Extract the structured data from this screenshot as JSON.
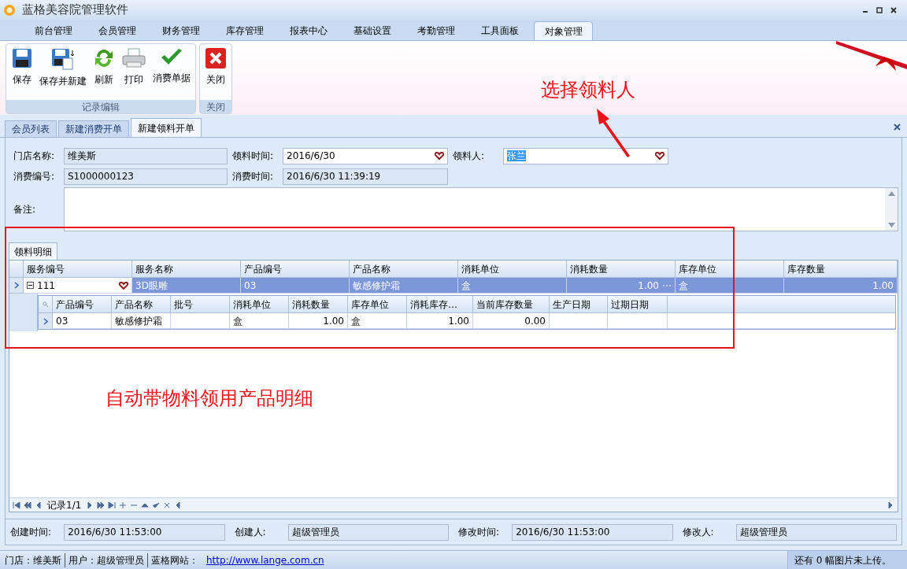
{
  "window": {
    "title": "蓝格美容院管理软件"
  },
  "menu_tabs": [
    {
      "label": "前台管理",
      "selected": false
    },
    {
      "label": "会员管理",
      "selected": false
    },
    {
      "label": "财务管理",
      "selected": false
    },
    {
      "label": "库存管理",
      "selected": false
    },
    {
      "label": "报表中心",
      "selected": false
    },
    {
      "label": "基础设置",
      "selected": false
    },
    {
      "label": "考勤管理",
      "selected": false
    },
    {
      "label": "工具面板",
      "selected": false
    },
    {
      "label": "对象管理",
      "selected": true
    }
  ],
  "ribbon": {
    "groups": [
      {
        "label": "记录编辑",
        "buttons": [
          {
            "label": "保存",
            "kind": "save"
          },
          {
            "label": "保存并新建",
            "kind": "save_new"
          },
          {
            "label": "刷新",
            "kind": "refresh"
          },
          {
            "label": "打印",
            "kind": "print"
          },
          {
            "label": "消费单据",
            "kind": "check"
          }
        ]
      },
      {
        "label": "关闭",
        "buttons": [
          {
            "label": "关闭",
            "kind": "close"
          }
        ]
      }
    ]
  },
  "doc_tabs": [
    {
      "label": "会员列表",
      "selected": false
    },
    {
      "label": "新建消费开单",
      "selected": false
    },
    {
      "label": "新建领料开单",
      "selected": true
    }
  ],
  "form": {
    "store": {
      "label": "门店名称:",
      "value": "维美斯"
    },
    "pick_time": {
      "label": "领料时间:",
      "value": "2016/6/30"
    },
    "picker": {
      "label": "领料人:",
      "value": "张兰",
      "selected": true
    },
    "consume_no": {
      "label": "消费编号:",
      "value": "S1000000123"
    },
    "consume_time": {
      "label": "消费时间:",
      "value": "2016/6/30 11:39:19"
    },
    "note": {
      "label": "备注:"
    }
  },
  "annotations": [
    {
      "text": "选择领料人"
    },
    {
      "text": "自动带物料领用产品明细"
    }
  ],
  "detail": {
    "tab": {
      "label": "领料明细",
      "selected": true
    },
    "columns": [
      {
        "label": "服务编号",
        "kind": "lookup"
      },
      {
        "label": "服务名称",
        "kind": "text"
      },
      {
        "label": "产品编号",
        "kind": "text"
      },
      {
        "label": "产品名称",
        "kind": "text"
      },
      {
        "label": "消耗单位",
        "kind": "text"
      },
      {
        "label": "消耗数量",
        "kind": "number_button"
      },
      {
        "label": "库存单位",
        "kind": "text"
      },
      {
        "label": "库存数量",
        "kind": "number"
      }
    ],
    "rows": [
      {
        "selected": true,
        "expanded": true,
        "cells": [
          "111",
          "3D眼雕",
          "03",
          "敏感修护霜",
          "盒",
          "1.00",
          "盒",
          "1.00"
        ],
        "sub_table": {
          "columns": [
            {
              "label": "产品编号",
              "kind": "text"
            },
            {
              "label": "产品名称",
              "kind": "text"
            },
            {
              "label": "批号",
              "kind": "text"
            },
            {
              "label": "消耗单位",
              "kind": "text"
            },
            {
              "label": "消耗数量",
              "kind": "number"
            },
            {
              "label": "库存单位",
              "kind": "text"
            },
            {
              "label": "消耗库存…",
              "kind": "number"
            },
            {
              "label": "当前库存数量",
              "kind": "number"
            },
            {
              "label": "生产日期",
              "kind": "text"
            },
            {
              "label": "过期日期",
              "kind": "text"
            }
          ],
          "rows": [
            {
              "cells": [
                "03",
                "敏感修护霜",
                "",
                "盒",
                "1.00",
                "盒",
                "1.00",
                "0.00",
                "",
                ""
              ]
            }
          ]
        }
      }
    ]
  },
  "pager": {
    "record": "记录1/1"
  },
  "audit": [
    {
      "label": "创建时间:",
      "value": "2016/6/30 11:53:00"
    },
    {
      "label": "创建人:",
      "value": "超级管理员"
    },
    {
      "label": "修改时间:",
      "value": "2016/6/30 11:53:00"
    },
    {
      "label": "修改人:",
      "value": "超级管理员"
    }
  ],
  "status_bar": {
    "items": [
      "门店：维美斯",
      "用户：超级管理员",
      "蓝格网站："
    ],
    "link": "http://www.lange.com.cn",
    "upload": "还有 0 幅图片未上传。"
  }
}
